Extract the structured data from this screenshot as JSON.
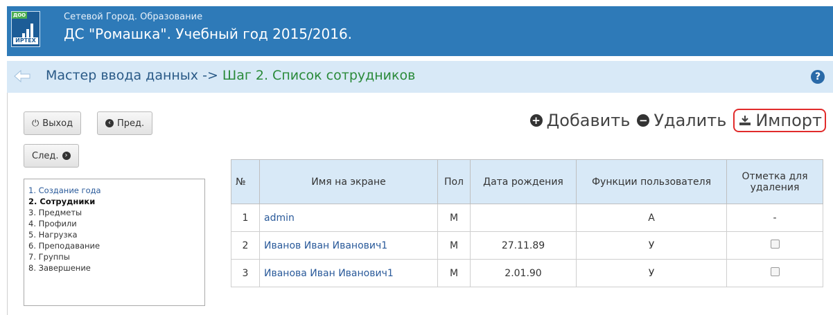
{
  "header": {
    "logo_tag": "ДОО",
    "logo_brand": "ИРТЕХ",
    "subtitle": "Сетевой Город. Образование",
    "title": "ДС \"Ромашка\". Учебный год 2015/2016."
  },
  "stepbar": {
    "prefix": "Мастер ввода данных -> ",
    "step": "Шаг 2. Список сотрудников",
    "help": "?"
  },
  "buttons": {
    "exit": "Выход",
    "prev": "Пред.",
    "next": "След."
  },
  "nav": {
    "items": [
      {
        "label": "1. Создание года"
      },
      {
        "label": "2. Сотрудники"
      },
      {
        "label": "3. Предметы"
      },
      {
        "label": "4. Профили"
      },
      {
        "label": "5. Нагрузка"
      },
      {
        "label": "6. Преподавание"
      },
      {
        "label": "7. Группы"
      },
      {
        "label": "8. Завершение"
      }
    ]
  },
  "actions": {
    "add": "Добавить",
    "remove": "Удалить",
    "import": "Импорт"
  },
  "table": {
    "headers": [
      "№",
      "Имя на экране",
      "Пол",
      "Дата рождения",
      "Функции пользователя",
      "Отметка для удаления"
    ],
    "rows": [
      {
        "num": "1",
        "name": "admin",
        "sex": "М",
        "dob": "",
        "role": "А",
        "mark": "-"
      },
      {
        "num": "2",
        "name": "Иванов Иван Иванович1",
        "sex": "М",
        "dob": "27.11.89",
        "role": "У",
        "mark": ""
      },
      {
        "num": "3",
        "name": "Иванова Иван Иванович1",
        "sex": "М",
        "dob": "2.01.90",
        "role": "У",
        "mark": ""
      }
    ]
  },
  "colors": {
    "header_bg": "#2e7ab8",
    "stepbar_bg": "#d8e9f7",
    "step_green": "#2a8a3a",
    "import_highlight": "#e12b2b"
  }
}
